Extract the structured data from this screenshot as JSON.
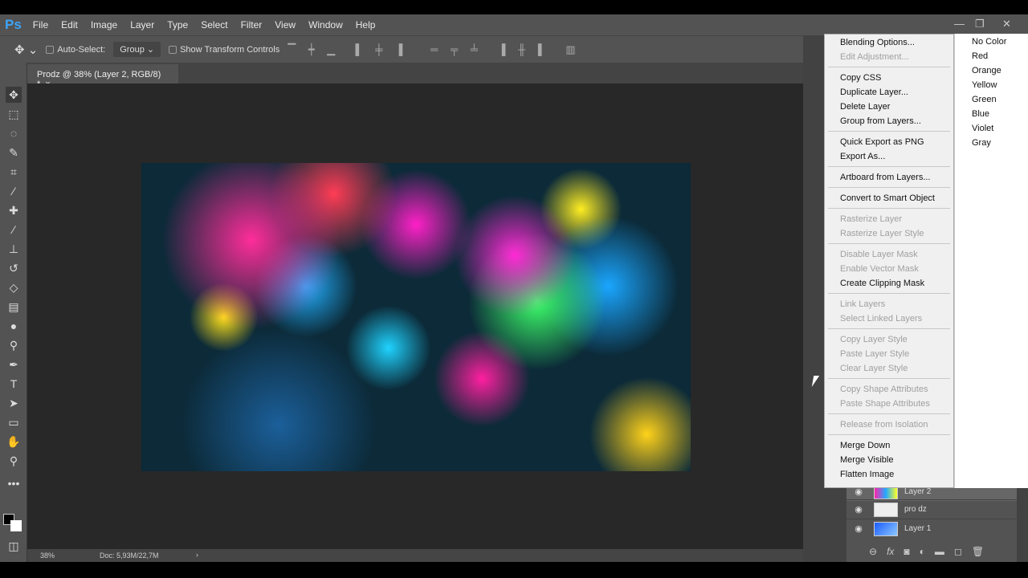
{
  "app": {
    "logo": "Ps",
    "menu": [
      "File",
      "Edit",
      "Image",
      "Layer",
      "Type",
      "Select",
      "Filter",
      "View",
      "Window",
      "Help"
    ]
  },
  "window_controls": {
    "minimize": "—",
    "restore": "❐",
    "close": "✕"
  },
  "options": {
    "auto_select": "Auto-Select:",
    "group": "Group",
    "show_transform": "Show Transform Controls"
  },
  "document": {
    "tab_title": "Prodz @ 38% (Layer 2, RGB/8) *",
    "close": "×",
    "zoom": "38%",
    "doc_info": "Doc: 5,93M/22,7M"
  },
  "context_menu": [
    {
      "label": "Blending Options...",
      "enabled": true
    },
    {
      "label": "Edit Adjustment...",
      "enabled": false
    },
    {
      "sep": true
    },
    {
      "label": "Copy CSS",
      "enabled": true
    },
    {
      "label": "Duplicate Layer...",
      "enabled": true
    },
    {
      "label": "Delete Layer",
      "enabled": true
    },
    {
      "label": "Group from Layers...",
      "enabled": true
    },
    {
      "sep": true
    },
    {
      "label": "Quick Export as PNG",
      "enabled": true
    },
    {
      "label": "Export As...",
      "enabled": true
    },
    {
      "sep": true
    },
    {
      "label": "Artboard from Layers...",
      "enabled": true
    },
    {
      "sep": true
    },
    {
      "label": "Convert to Smart Object",
      "enabled": true
    },
    {
      "sep": true
    },
    {
      "label": "Rasterize Layer",
      "enabled": false
    },
    {
      "label": "Rasterize Layer Style",
      "enabled": false
    },
    {
      "sep": true
    },
    {
      "label": "Disable Layer Mask",
      "enabled": false
    },
    {
      "label": "Enable Vector Mask",
      "enabled": false
    },
    {
      "label": "Create Clipping Mask",
      "enabled": true
    },
    {
      "sep": true
    },
    {
      "label": "Link Layers",
      "enabled": false
    },
    {
      "label": "Select Linked Layers",
      "enabled": false
    },
    {
      "sep": true
    },
    {
      "label": "Copy Layer Style",
      "enabled": false
    },
    {
      "label": "Paste Layer Style",
      "enabled": false
    },
    {
      "label": "Clear Layer Style",
      "enabled": false
    },
    {
      "sep": true
    },
    {
      "label": "Copy Shape Attributes",
      "enabled": false
    },
    {
      "label": "Paste Shape Attributes",
      "enabled": false
    },
    {
      "sep": true
    },
    {
      "label": "Release from Isolation",
      "enabled": false
    },
    {
      "sep": true
    },
    {
      "label": "Merge Down",
      "enabled": true
    },
    {
      "label": "Merge Visible",
      "enabled": true
    },
    {
      "label": "Flatten Image",
      "enabled": true
    }
  ],
  "color_submenu": [
    "No Color",
    "Red",
    "Orange",
    "Yellow",
    "Green",
    "Blue",
    "Violet",
    "Gray"
  ],
  "layers": [
    {
      "name": "Layer 2"
    },
    {
      "name": "pro dz"
    },
    {
      "name": "Layer 1"
    }
  ],
  "layer_buttons": [
    "link-icon",
    "fx-icon",
    "mask-icon",
    "adjustment-icon",
    "folder-icon",
    "new-layer-icon",
    "trash-icon"
  ]
}
